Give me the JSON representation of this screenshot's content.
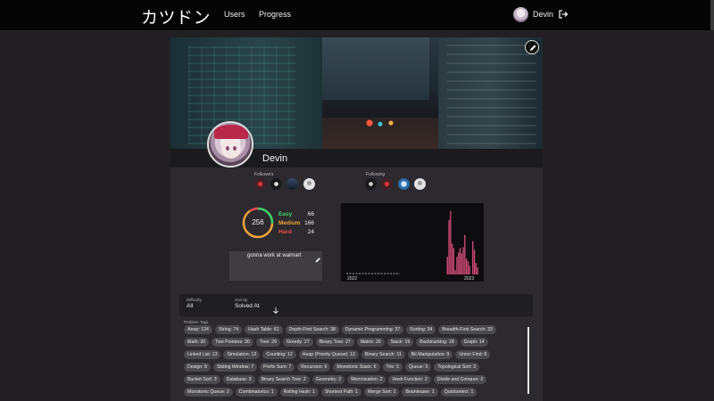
{
  "nav": {
    "brand": "カツドン",
    "links": [
      "Users",
      "Progress"
    ],
    "user": "Devin"
  },
  "profile": {
    "name": "Devin",
    "followers_label": "Followers",
    "following_label": "Following",
    "bio": "gonna work at walmart"
  },
  "stats": {
    "total": "256",
    "easy_label": "Easy",
    "easy": "66",
    "medium_label": "Medium",
    "medium": "166",
    "hard_label": "Hard",
    "hard": "24",
    "colors": {
      "easy": "#3fd16c",
      "medium": "#f1a43a",
      "hard": "#ee4b4b"
    }
  },
  "chart_data": {
    "type": "bar",
    "x_tick_labels": [
      "2022",
      "2023"
    ],
    "values": [
      0,
      0,
      0,
      0,
      0,
      0,
      0,
      0,
      0,
      0,
      0,
      0,
      0,
      0,
      0,
      0,
      0,
      0,
      0,
      0,
      0,
      0,
      0,
      0,
      0,
      0,
      0,
      0,
      0,
      0,
      0,
      0,
      0,
      0,
      0,
      0,
      0,
      0,
      0,
      0,
      0,
      0,
      0,
      0,
      0,
      0,
      0,
      0,
      0,
      0,
      0,
      0,
      0,
      0,
      0,
      0,
      0,
      0,
      0,
      0,
      0,
      0,
      0,
      20,
      62,
      72,
      35,
      30,
      5,
      20,
      25,
      30,
      24,
      31,
      45,
      18,
      15,
      10,
      0,
      38,
      28,
      13,
      8
    ],
    "bar_color": "#e0507f",
    "ymax": 75
  },
  "filters": {
    "difficulty_label": "Difficulty",
    "difficulty_value": "All",
    "sort_label": "Sort by",
    "sort_value": "Solved At"
  },
  "tags_label": "Problem Tags",
  "tags": [
    [
      "Array: 124",
      "String: 74",
      "Hash Table: 61",
      "Depth-First Search: 38",
      "Dynamic Programming: 37",
      "Sorting: 34",
      "Breadth-First Search: 33"
    ],
    [
      "Math: 30",
      "Two Pointers: 30",
      "Tree: 29",
      "Greedy: 27",
      "Binary Tree: 27",
      "Matrix: 20",
      "Stack: 19",
      "Backtracking: 18",
      "Graph: 14"
    ],
    [
      "Linked List: 13",
      "Simulation: 12",
      "Counting: 12",
      "Heap (Priority Queue): 12",
      "Binary Search: 11",
      "Bit Manipulation: 9",
      "Union Find: 8"
    ],
    [
      "Design: 8",
      "Sliding Window: 7",
      "Prefix Sum: 7",
      "Recursion: 6",
      "Monotonic Stack: 6",
      "Trie: 5",
      "Queue: 5",
      "Topological Sort: 3"
    ],
    [
      "Bucket Sort: 3",
      "Database: 3",
      "Binary Search Tree: 2",
      "Geometry: 2",
      "Memoization: 2",
      "Hash Function: 2",
      "Divide and Conquer: 2"
    ],
    [
      "Monotonic Queue: 2",
      "Combinatorics: 1",
      "Rolling Hash: 1",
      "Shortest Path: 1",
      "Merge Sort: 1",
      "Brainteaser: 1",
      "Quickselect: 1"
    ]
  ]
}
